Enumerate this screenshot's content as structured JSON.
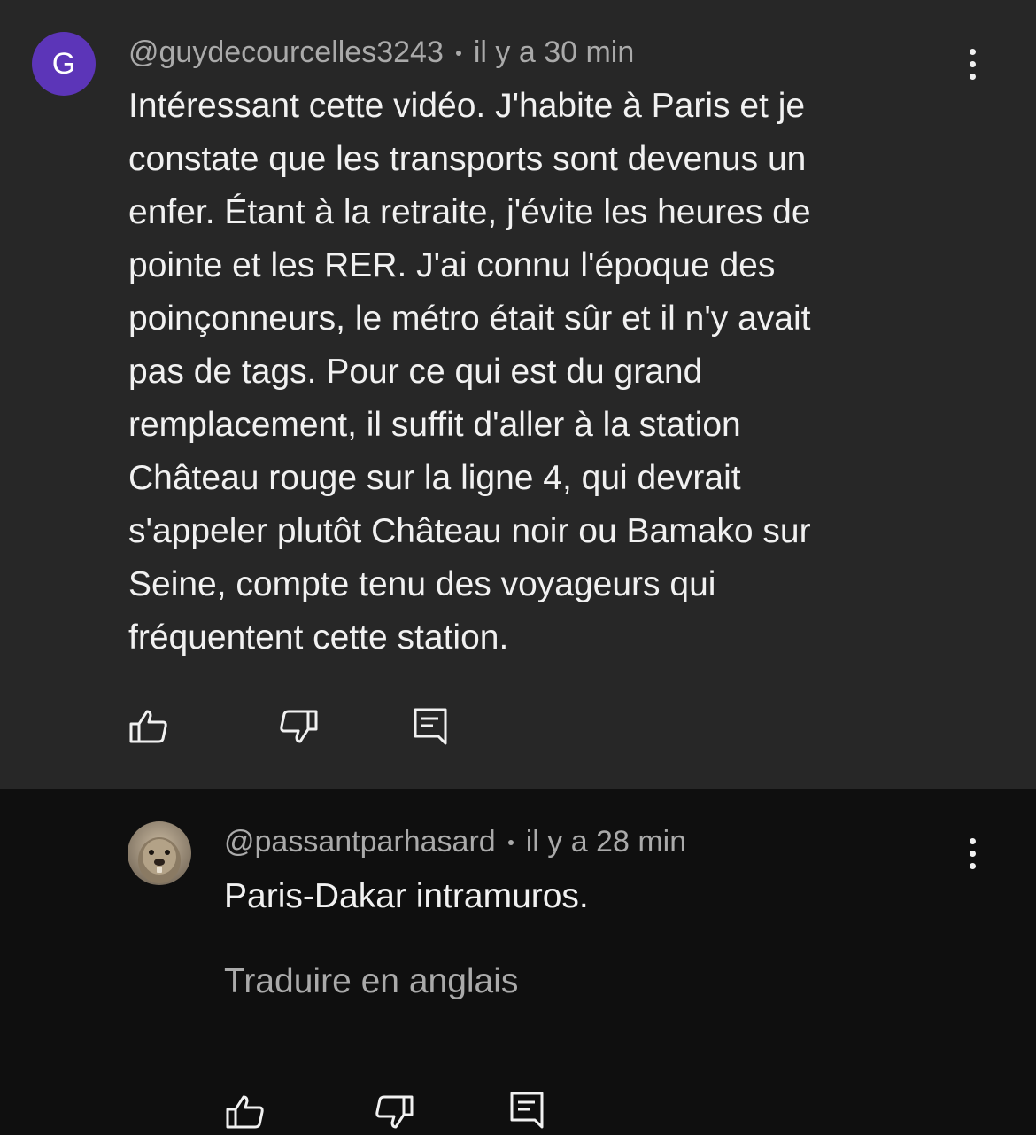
{
  "comments": [
    {
      "avatar_letter": "G",
      "author": "@guydecourcelles3243",
      "time": "il y a 30 min",
      "text_lines": [
        "Intéressant cette vidéo. J'habite à Paris et je",
        "constate que les transports sont devenus un",
        "enfer. Étant à la retraite, j'évite les heures de",
        "pointe et les RER. J'ai connu l'époque des",
        "poinçonneurs, le métro était sûr et il n'y avait",
        "pas de tags. Pour ce qui est du grand",
        "remplacement, il suffit d'aller à la station",
        "Château rouge sur la ligne 4, qui devrait",
        "s'appeler plutôt Château noir ou Bamako sur",
        "Seine, compte tenu des voyageurs qui",
        "fréquentent cette station."
      ],
      "actions": [
        "like-icon",
        "dislike-icon",
        "reply-icon"
      ],
      "menu_icon": "more-vertical-icon"
    },
    {
      "author": "@passantparhasard",
      "time": "il y a 28 min",
      "text": "Paris-Dakar intramuros.",
      "translate_label": "Traduire en anglais",
      "avatar_icon": "marmot-avatar",
      "actions": [
        "like-icon",
        "dislike-icon",
        "reply-icon"
      ],
      "menu_icon": "more-vertical-icon"
    }
  ],
  "colors": {
    "top_background": "#272727",
    "reply_background": "#0f0f0f",
    "avatar_purple": "#5c35b8",
    "meta_gray": "#aaaaaa",
    "text_white": "#f1f1f1"
  }
}
